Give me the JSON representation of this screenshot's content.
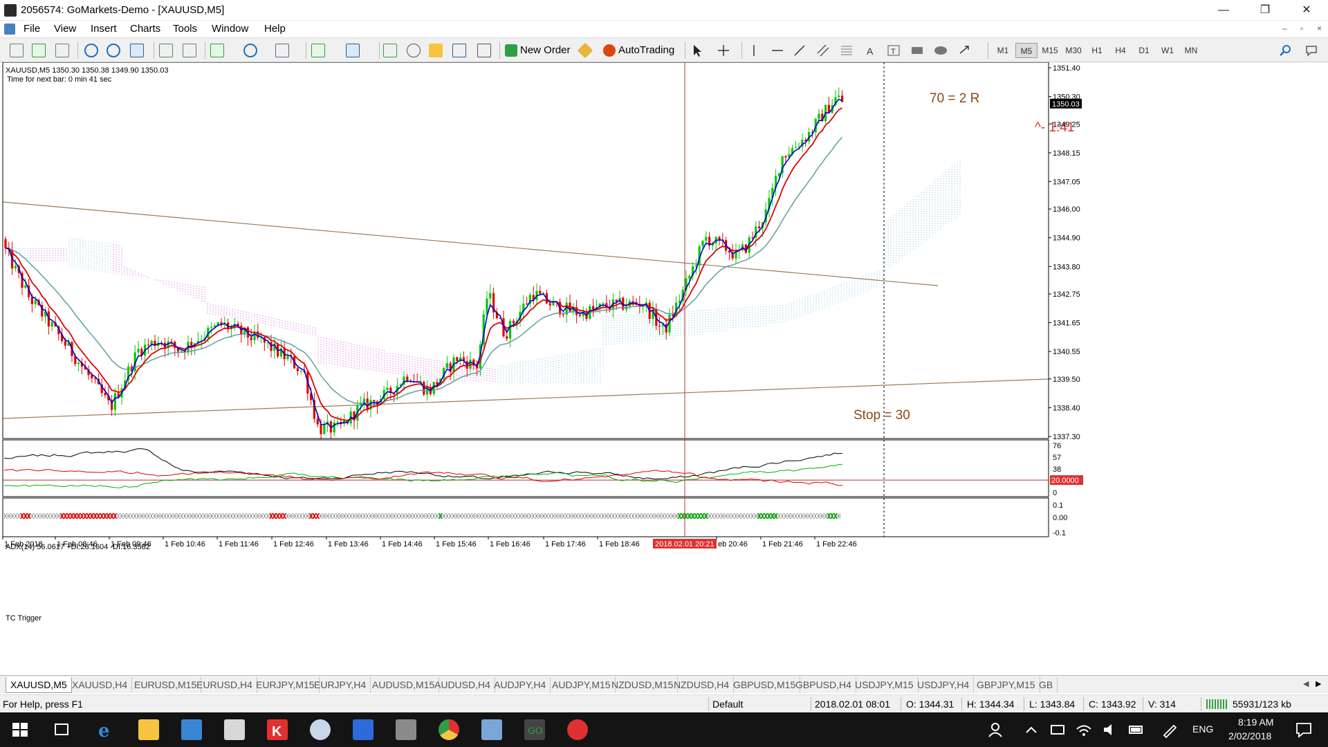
{
  "window": {
    "title": "2056574: GoMarkets-Demo - [XAUUSD,M5]",
    "min_glyph": "—",
    "restore_glyph": "❐",
    "close_glyph": "✕"
  },
  "menu": [
    "File",
    "View",
    "Insert",
    "Charts",
    "Tools",
    "Window",
    "Help"
  ],
  "mdi": {
    "min": "–",
    "restore": "▫",
    "close": "×"
  },
  "toolbar": {
    "new_order": "New Order",
    "auto_trading": "AutoTrading",
    "timeframes": [
      "M1",
      "M5",
      "M15",
      "M30",
      "H1",
      "H4",
      "D1",
      "W1",
      "MN"
    ],
    "active_timeframe": "M5",
    "icon_colors": {
      "new_order": "#2f9e44",
      "auto_trading": "#d9480f",
      "zoom": "#1971c2"
    }
  },
  "chart": {
    "header": "XAUUSD,M5  1350.30 1350.38 1349.90 1350.03",
    "timer": "Time for next bar: 0 min 41 sec",
    "price_current": "1350.03",
    "price_labels": [
      "1351.40",
      "1350.30",
      "1349.25",
      "1348.15",
      "1347.05",
      "1346.00",
      "1344.90",
      "1343.80",
      "1342.75",
      "1341.65",
      "1340.55",
      "1339.50",
      "1338.40",
      "1337.30"
    ],
    "price_levels": [
      1351.4,
      1350.3,
      1349.25,
      1348.15,
      1347.05,
      1346.0,
      1344.9,
      1343.8,
      1342.75,
      1341.65,
      1340.55,
      1339.5,
      1338.4,
      1337.3
    ],
    "annotations": {
      "target": "70 = 2 R",
      "ratio": "^- 1:41",
      "stop": "Stop = 30"
    },
    "colors": {
      "bull_candle": "#00c800",
      "bear_candle": "#e00000",
      "ma_fast": "#0000cc",
      "ma_mid": "#e00000",
      "ma_slow": "#5f9ea0",
      "cloud_top": "#cc33cc",
      "cloud_bottom": "#66bbdd",
      "trendline": "#9b7b5b",
      "vline": "#c03030",
      "annotation": "#8b4513",
      "ratio": "#d83030"
    }
  },
  "adx": {
    "label": "ADX(14) 56.0617 +DI:28.1604 -DI:16.3582",
    "scale": [
      "76",
      "57",
      "38",
      "19",
      "0"
    ],
    "level_label": "20.0000"
  },
  "tc": {
    "label": "TC Trigger",
    "scale": [
      "0.1",
      "0.00",
      "-0.1"
    ]
  },
  "time_axis": [
    "1 Feb 2018",
    "1 Feb 08:46",
    "1 Feb 09:46",
    "1 Feb 10:46",
    "1 Feb 11:46",
    "1 Feb 12:46",
    "1 Feb 13:46",
    "1 Feb 14:46",
    "1 Feb 15:46",
    "1 Feb 16:46",
    "1 Feb 17:46",
    "1 Feb 18:46",
    "eb 20:46",
    "1 Feb 21:46",
    "1 Feb 22:46"
  ],
  "time_cursor": "2018.02.01 20:21",
  "tabs": [
    "XAUUSD,M5",
    "XAUUSD,H4",
    "EURUSD,M15",
    "EURUSD,H4",
    "EURJPY,M15",
    "EURJPY,H4",
    "AUDUSD,M15",
    "AUDUSD,H4",
    "AUDJPY,H4",
    "AUDJPY,M15",
    "NZDUSD,M15",
    "NZDUSD,H4",
    "GBPUSD,M15",
    "GBPUSD,H4",
    "USDJPY,M15",
    "USDJPY,H4",
    "GBPJPY,M15",
    "GB"
  ],
  "active_tab": "XAUUSD,M5",
  "status": {
    "help": "For Help, press F1",
    "profile": "Default",
    "datetime": "2018.02.01 08:01",
    "open": "O: 1344.31",
    "high": "H: 1344.34",
    "low": "L: 1343.84",
    "close": "C: 1343.92",
    "volume": "V: 314",
    "traffic": "55931/123 kb"
  },
  "taskbar": {
    "lang": "ENG",
    "time": "8:19 AM",
    "date": "2/02/2018"
  }
}
